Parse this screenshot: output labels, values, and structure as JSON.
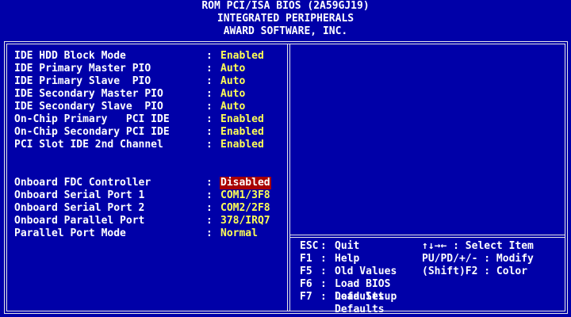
{
  "header": {
    "line1": "ROM PCI/ISA BIOS (2A59GJ19)",
    "line2": "INTEGRATED PERIPHERALS",
    "line3": "AWARD SOFTWARE, INC."
  },
  "settings_group1": [
    {
      "label": "IDE HDD Block Mode",
      "sep": ":",
      "value": "Enabled"
    },
    {
      "label": "IDE Primary Master PIO",
      "sep": ":",
      "value": "Auto"
    },
    {
      "label": "IDE Primary Slave  PIO",
      "sep": ":",
      "value": "Auto"
    },
    {
      "label": "IDE Secondary Master PIO",
      "sep": ":",
      "value": "Auto"
    },
    {
      "label": "IDE Secondary Slave  PIO",
      "sep": ":",
      "value": "Auto"
    },
    {
      "label": "On-Chip Primary   PCI IDE",
      "sep": ":",
      "value": "Enabled"
    },
    {
      "label": "On-Chip Secondary PCI IDE",
      "sep": ":",
      "value": "Enabled"
    },
    {
      "label": "PCI Slot IDE 2nd Channel",
      "sep": ":",
      "value": "Enabled"
    }
  ],
  "settings_group2": [
    {
      "label": "Onboard FDC Controller",
      "sep": ":",
      "value": "Disabled",
      "selected": true
    },
    {
      "label": "Onboard Serial Port 1",
      "sep": ":",
      "value": "COM1/3F8"
    },
    {
      "label": "Onboard Serial Port 2",
      "sep": ":",
      "value": "COM2/2F8"
    },
    {
      "label": "Onboard Parallel Port",
      "sep": ":",
      "value": "378/IRQ7"
    },
    {
      "label": "Parallel Port Mode",
      "sep": ":",
      "value": "Normal"
    }
  ],
  "help": [
    {
      "key": "ESC",
      "sep": ":",
      "action": "Quit",
      "right": "↑↓→← : Select Item"
    },
    {
      "key": "F1",
      "sep": ":",
      "action": "Help",
      "right": "PU/PD/+/- : Modify"
    },
    {
      "key": "F5",
      "sep": ":",
      "action": "Old Values",
      "right": "(Shift)F2 : Color"
    },
    {
      "key": "F6",
      "sep": ":",
      "action": "Load BIOS  Defaults",
      "right": ""
    },
    {
      "key": "F7",
      "sep": ":",
      "action": "Load Setup Defaults",
      "right": ""
    }
  ],
  "colors": {
    "background": "#0000a8",
    "text": "#ffffff",
    "value": "#ffff55",
    "highlight": "#a80000"
  }
}
